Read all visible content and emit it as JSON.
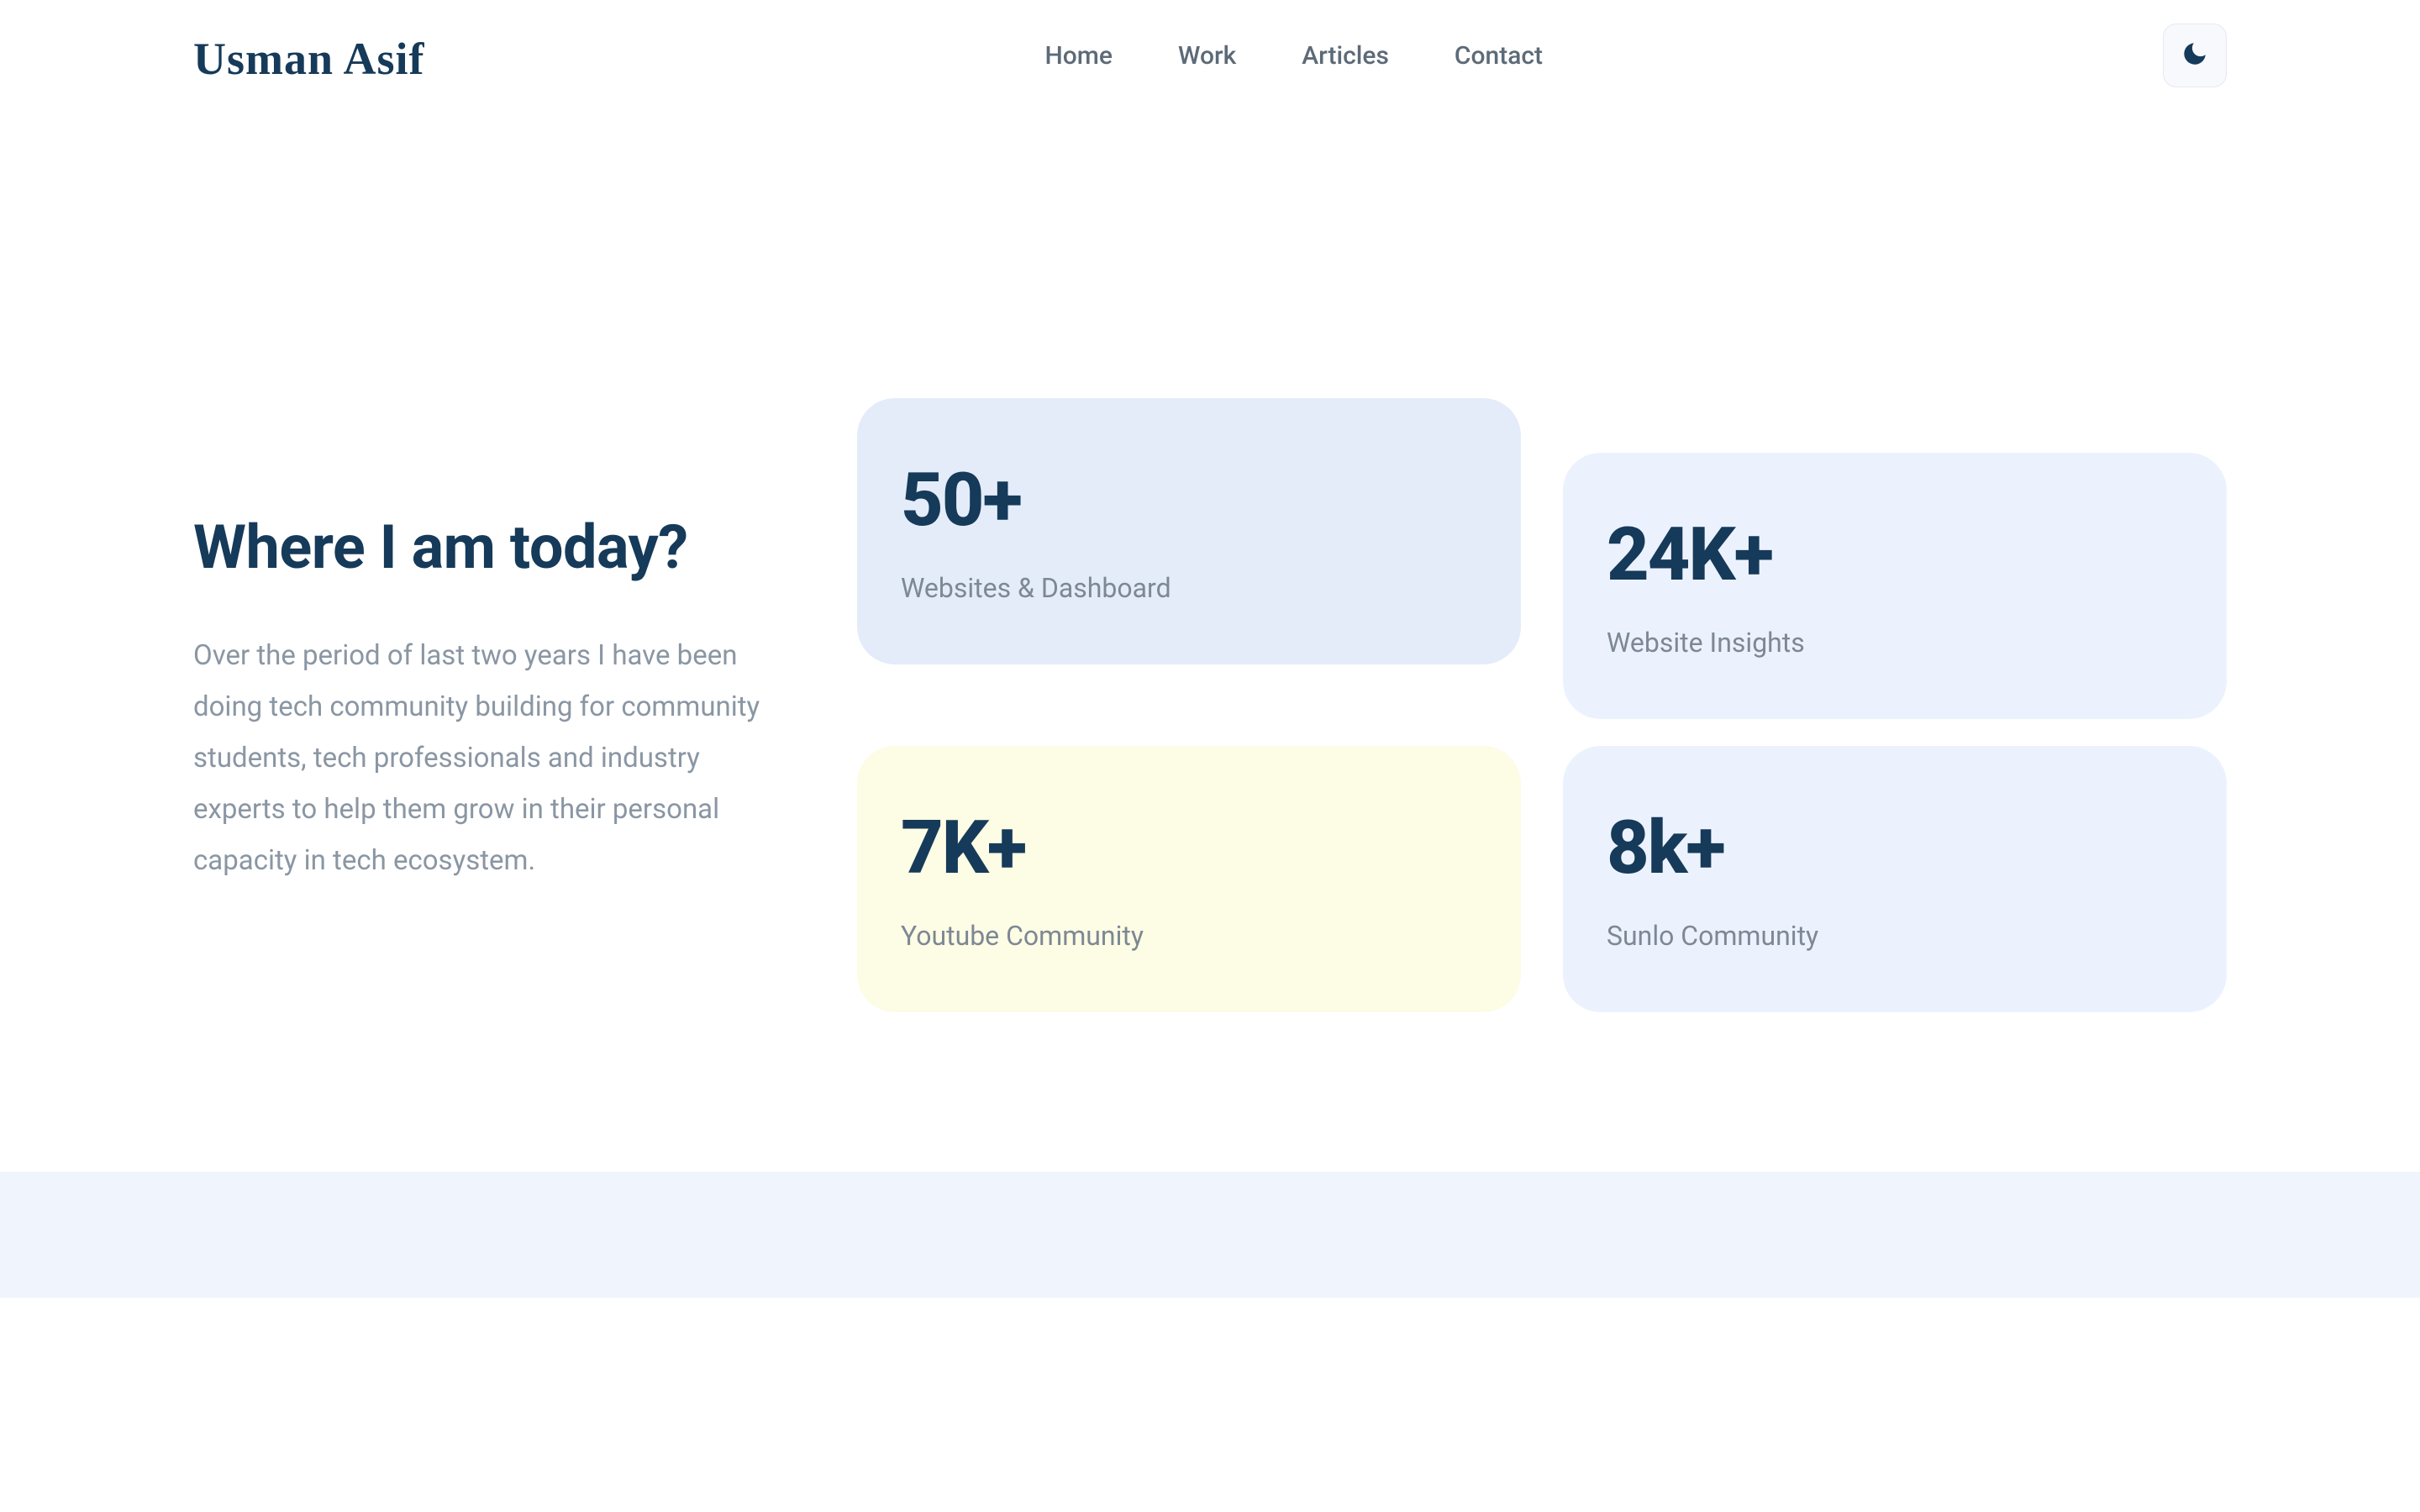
{
  "brand": {
    "logo_text": "Usman Asif"
  },
  "nav": {
    "items": [
      {
        "label": "Home"
      },
      {
        "label": "Work"
      },
      {
        "label": "Articles"
      },
      {
        "label": "Contact"
      }
    ]
  },
  "hero": {
    "title": "Where I am today?",
    "body": "Over the period of last two years I have been doing tech community building for community students, tech professionals and industry experts to help them grow in their personal capacity in tech ecosystem."
  },
  "stats": [
    {
      "value": "50+",
      "label": "Websites & Dashboard"
    },
    {
      "value": "24K+",
      "label": "Website Insights"
    },
    {
      "value": "7K+",
      "label": "Youtube Community"
    },
    {
      "value": "8k+",
      "label": "Sunlo Community"
    }
  ]
}
